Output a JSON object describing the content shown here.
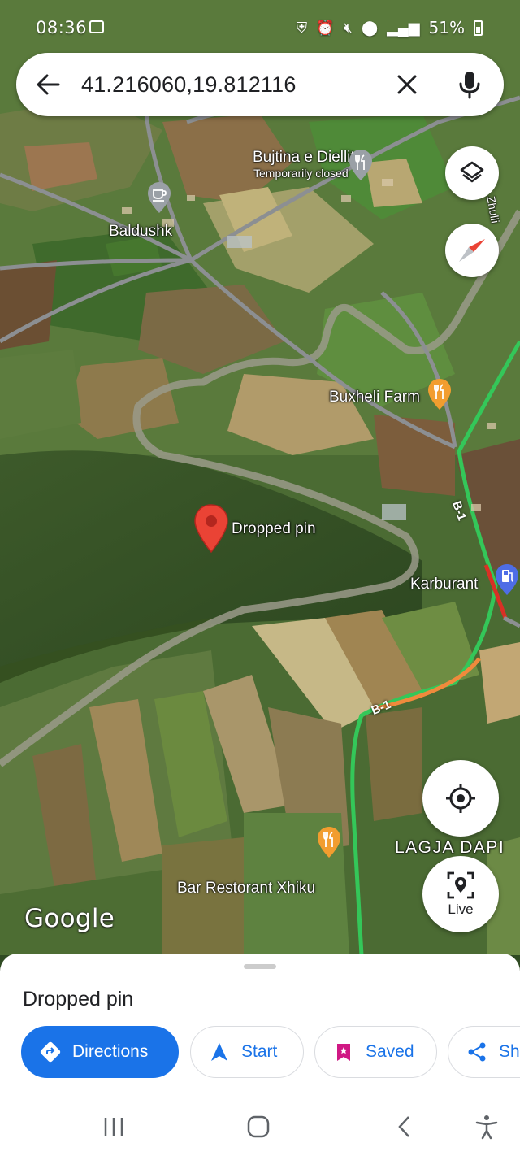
{
  "status_bar": {
    "time": "08:36",
    "battery": "51%"
  },
  "search": {
    "query": "41.216060,19.812116"
  },
  "map": {
    "labels": {
      "bujtina": "Bujtina e Diellit",
      "temporarily_closed": "Temporarily closed",
      "baldushk": "Baldushk",
      "buxheli": "Buxheli Farm",
      "dropped_pin": "Dropped pin",
      "karburant": "Karburant",
      "lagja": "LAGJA DAPI",
      "bar": "Bar Restorant Xhiku",
      "zhulli": "Zhulli",
      "road1": "B-1",
      "road2": "B-1"
    },
    "watermark": "Google",
    "live_label": "Live",
    "colors": {
      "traffic_green": "#34c759",
      "traffic_orange": "#f08a3c",
      "traffic_red": "#d93025",
      "pin_red": "#ea4335",
      "poi_orange": "#f29d2f",
      "poi_gray": "#9aa0a6",
      "fuel_blue": "#4e6de6"
    }
  },
  "sheet": {
    "title": "Dropped pin",
    "actions": {
      "directions": "Directions",
      "start": "Start",
      "saved": "Saved",
      "share": "Share"
    }
  },
  "colors": {
    "accent": "#1a73e8"
  }
}
